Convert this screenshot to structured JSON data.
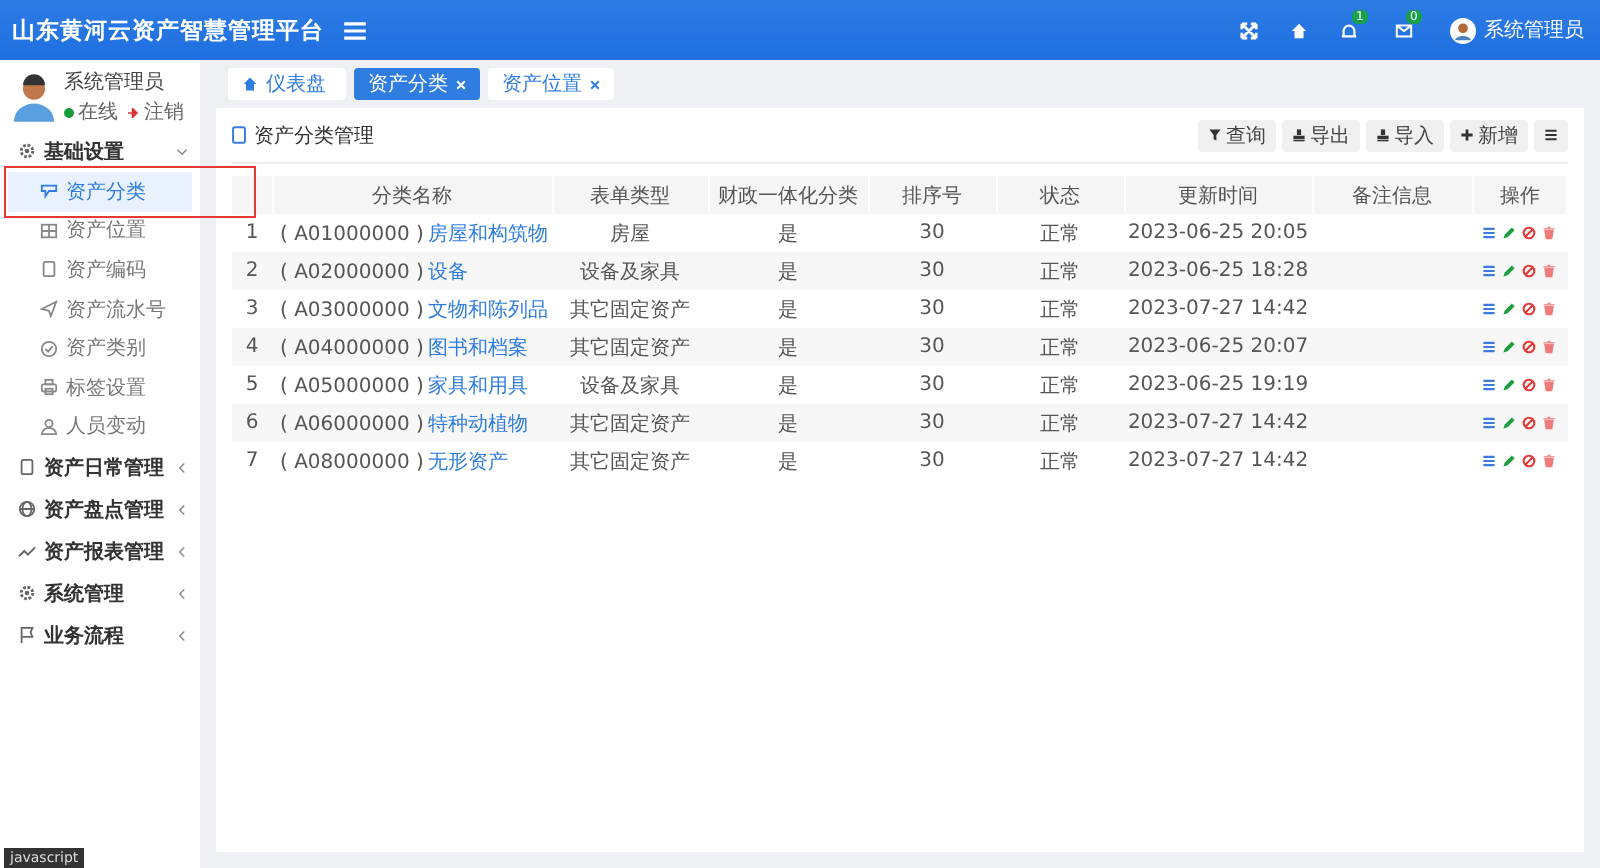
{
  "header": {
    "title": "山东黄河云资产智慧管理平台",
    "notifications": "1",
    "messages": "0",
    "user": "系统管理员"
  },
  "sidebar": {
    "user": {
      "name": "系统管理员",
      "status": "在线",
      "logout": "注销"
    },
    "groups": [
      {
        "label": "基础设置",
        "expanded": true,
        "children": [
          {
            "label": "资产分类",
            "selected": true,
            "highlighted": true
          },
          {
            "label": "资产位置",
            "selected": false,
            "highlighted": false
          },
          {
            "label": "资产编码",
            "selected": false,
            "highlighted": false
          },
          {
            "label": "资产流水号",
            "selected": false,
            "highlighted": false
          },
          {
            "label": "资产类别",
            "selected": false,
            "highlighted": false
          },
          {
            "label": "标签设置",
            "selected": false,
            "highlighted": false
          },
          {
            "label": "人员变动",
            "selected": false,
            "highlighted": false
          }
        ]
      },
      {
        "label": "资产日常管理",
        "expanded": false
      },
      {
        "label": "资产盘点管理",
        "expanded": false
      },
      {
        "label": "资产报表管理",
        "expanded": false
      },
      {
        "label": "系统管理",
        "expanded": false
      },
      {
        "label": "业务流程",
        "expanded": false
      }
    ]
  },
  "tabs": [
    {
      "label": "仪表盘",
      "kind": "home",
      "selected": false
    },
    {
      "label": "资产分类",
      "kind": "closable",
      "selected": true
    },
    {
      "label": "资产位置",
      "kind": "closable",
      "selected": false
    }
  ],
  "panel": {
    "title": "资产分类管理",
    "buttons": [
      {
        "label": "查询",
        "kind": "text"
      },
      {
        "label": "导出",
        "kind": "text"
      },
      {
        "label": "导入",
        "kind": "text"
      },
      {
        "label": "新增",
        "kind": "text"
      },
      {
        "kind": "menu"
      }
    ]
  },
  "table": {
    "columns": [
      "",
      "分类名称",
      "表单类型",
      "财政一体化分类",
      "排序号",
      "状态",
      "更新时间",
      "备注信息",
      "操作"
    ],
    "rows": [
      {
        "index": "1",
        "code": "( A01000000 )",
        "name": "房屋和构筑物",
        "type": "房屋",
        "fiscal": "是",
        "order": "30",
        "status": "正常",
        "updated": "2023-06-25 20:05"
      },
      {
        "index": "2",
        "code": "( A02000000 )",
        "name": "设备",
        "type": "设备及家具",
        "fiscal": "是",
        "order": "30",
        "status": "正常",
        "updated": "2023-06-25 18:28"
      },
      {
        "index": "3",
        "code": "( A03000000 )",
        "name": "文物和陈列品",
        "type": "其它固定资产",
        "fiscal": "是",
        "order": "30",
        "status": "正常",
        "updated": "2023-07-27 14:42"
      },
      {
        "index": "4",
        "code": "( A04000000 )",
        "name": "图书和档案",
        "type": "其它固定资产",
        "fiscal": "是",
        "order": "30",
        "status": "正常",
        "updated": "2023-06-25 20:07"
      },
      {
        "index": "5",
        "code": "( A05000000 )",
        "name": "家具和用具",
        "type": "设备及家具",
        "fiscal": "是",
        "order": "30",
        "status": "正常",
        "updated": "2023-06-25 19:19"
      },
      {
        "index": "6",
        "code": "( A06000000 )",
        "name": "特种动植物",
        "type": "其它固定资产",
        "fiscal": "是",
        "order": "30",
        "status": "正常",
        "updated": "2023-07-27 14:42"
      },
      {
        "index": "7",
        "code": "( A08000000 )",
        "name": "无形资产",
        "type": "其它固定资产",
        "fiscal": "是",
        "order": "30",
        "status": "正常",
        "updated": "2023-07-27 14:42"
      }
    ]
  },
  "status_bar": "javascript"
}
